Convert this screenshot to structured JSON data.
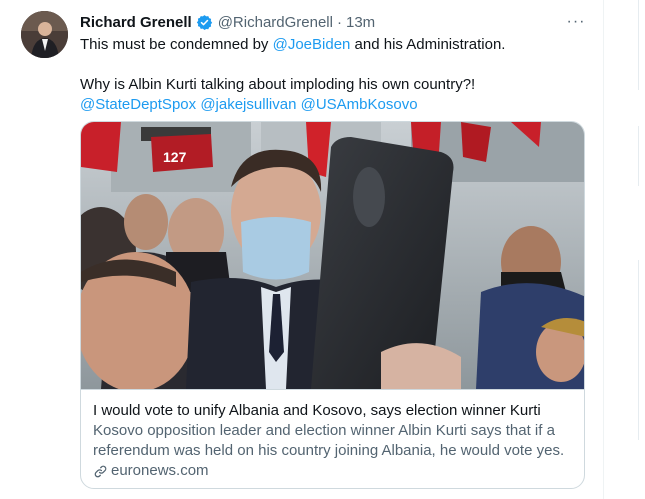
{
  "tweet": {
    "author_name": "Richard Grenell",
    "author_handle": "@RichardGrenell",
    "separator": "·",
    "time": "13m",
    "more_label": "···",
    "line1_prefix": "This must be condemned by ",
    "line1_mention": "@JoeBiden",
    "line1_suffix": " and his Administration.",
    "line2": "Why is Albin Kurti talking about imploding his own country?!",
    "mentions": [
      "@StateDeptSpox",
      "@jakejsullivan",
      "@USAmbKosovo"
    ]
  },
  "card": {
    "title": "I would vote to unify Albania and Kosovo, says election winner Kurti",
    "description": "Kosovo opposition leader and election winner Albin Kurti says that if a referendum was held on his country joining Albania, he would vote yes.",
    "domain": "euronews.com",
    "sign_text": "127"
  },
  "colors": {
    "accent": "#1d9bf0",
    "text": "#0f1419",
    "secondary": "#536471",
    "border": "#cfd9de"
  },
  "icons": [
    "verified-badge-icon",
    "more-icon",
    "link-icon"
  ]
}
